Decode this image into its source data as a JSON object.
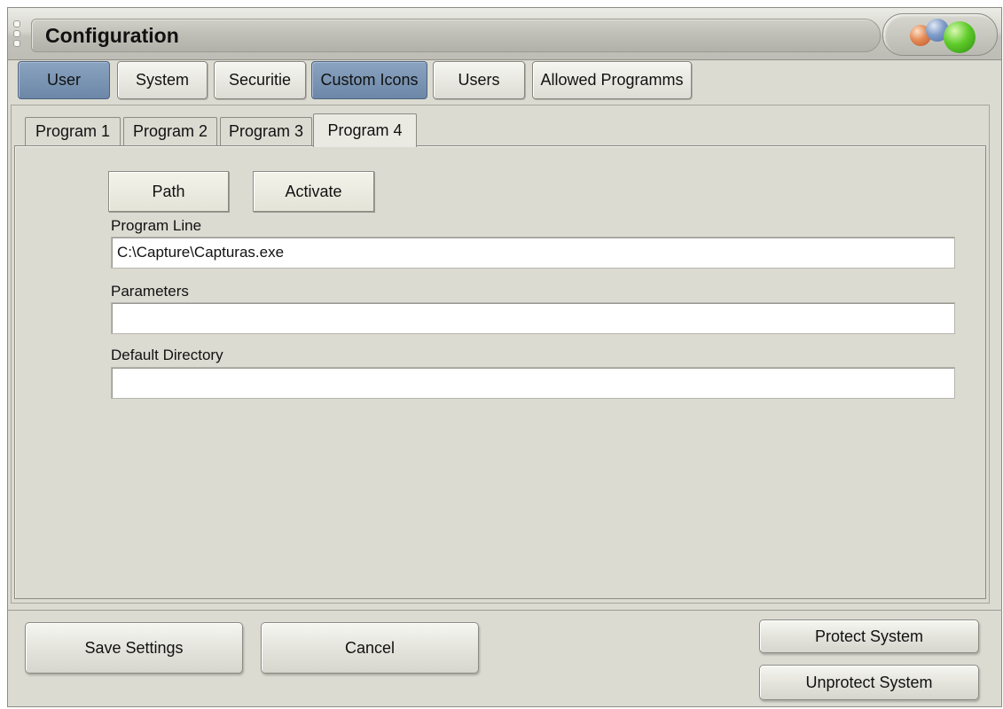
{
  "window": {
    "title": "Configuration"
  },
  "tabs": [
    {
      "label": "User",
      "active": true
    },
    {
      "label": "System",
      "active": false
    },
    {
      "label": "Securitie",
      "active": false
    },
    {
      "label": "Custom Icons",
      "active": true
    },
    {
      "label": "Users",
      "active": false
    },
    {
      "label": "Allowed Programms",
      "active": false
    }
  ],
  "subtabs": [
    {
      "label": "Program 1",
      "active": false
    },
    {
      "label": "Program 2",
      "active": false
    },
    {
      "label": "Program 3",
      "active": false
    },
    {
      "label": "Program 4",
      "active": true
    }
  ],
  "program": {
    "path_button": "Path",
    "activate_button": "Activate",
    "program_line_label": "Program Line",
    "program_line_value": "C:\\Capture\\Capturas.exe",
    "parameters_label": "Parameters",
    "parameters_value": "",
    "default_directory_label": "Default Directory",
    "default_directory_value": ""
  },
  "footer": {
    "save_label": "Save Settings",
    "cancel_label": "Cancel",
    "protect_label": "Protect System",
    "unprotect_label": "Unprotect System"
  },
  "colors": {
    "background": "#dcdbd2",
    "active_tab": "#7b94b4",
    "orb_orange": "#e58a55",
    "orb_blue": "#7f9cc9",
    "orb_green": "#5fcc2a"
  }
}
